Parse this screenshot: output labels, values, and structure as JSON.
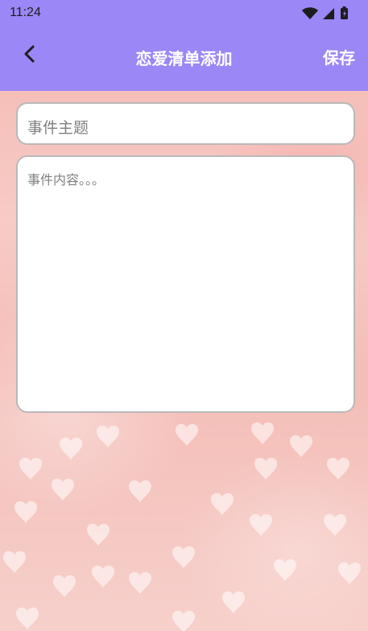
{
  "status_bar": {
    "time": "11:24",
    "icons": [
      "wifi-icon",
      "signal-icon",
      "battery-icon"
    ]
  },
  "app_bar": {
    "back_icon": "chevron-left-icon",
    "title": "恋爱清单添加",
    "save_label": "保存",
    "color": "#9b87f5"
  },
  "form": {
    "subject_placeholder": "事件主题",
    "content_placeholder": "事件内容。。。"
  },
  "background": {
    "style": "pink glitter with white hearts",
    "color": "#f6c9c4"
  }
}
